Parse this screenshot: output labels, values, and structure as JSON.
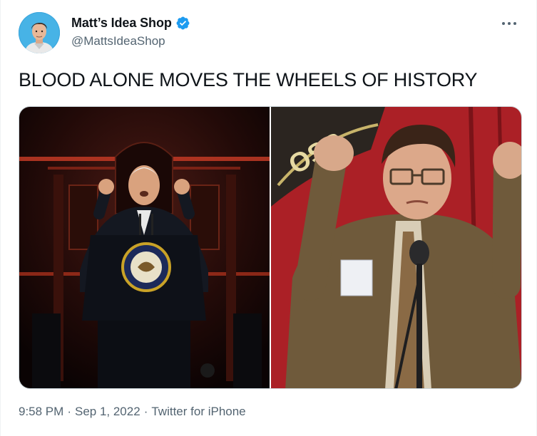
{
  "author": {
    "display_name": "Matt’s Idea Shop",
    "handle": "@MattsIdeaShop",
    "verified": true,
    "avatar_icon": "avatar-photo"
  },
  "tweet": {
    "text": "BLOOD ALONE MOVES THE WHEELS OF HISTORY",
    "media": [
      {
        "name": "photo-left",
        "description_icon": "speaker-at-podium-photo"
      },
      {
        "name": "photo-right",
        "description_icon": "man-fists-raised-photo"
      }
    ]
  },
  "meta": {
    "time": "9:58 PM",
    "separator": "·",
    "date": "Sep 1, 2022",
    "source": "Twitter for iPhone"
  },
  "icons": {
    "more": "more-options-icon",
    "verified": "verified-badge-icon"
  },
  "colors": {
    "text_primary": "#0f1419",
    "text_secondary": "#536471",
    "verified_blue": "#1d9bf0",
    "border": "#cfd9de"
  }
}
